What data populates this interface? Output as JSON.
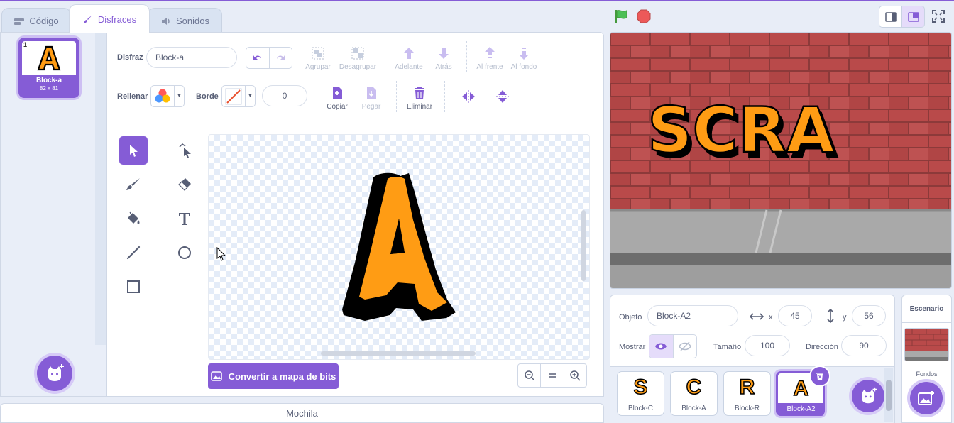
{
  "tabs": {
    "code": "Código",
    "costumes": "Disfraces",
    "sounds": "Sonidos"
  },
  "costume_list": [
    {
      "index": "1",
      "name": "Block-a",
      "size": "82 x 81"
    }
  ],
  "editor": {
    "costume_label": "Disfraz",
    "costume_name": "Block-a",
    "group": "Agrupar",
    "ungroup": "Desagrupar",
    "forward": "Adelante",
    "backward": "Atrás",
    "front": "Al frente",
    "back": "Al fondo",
    "fill_label": "Rellenar",
    "outline_label": "Borde",
    "outline_width": "0",
    "copy": "Copiar",
    "paste": "Pegar",
    "delete": "Eliminar",
    "convert_button": "Convertir a mapa de bits",
    "canvas_letter": "A"
  },
  "backpack": "Mochila",
  "stage": {
    "text": "SCRA"
  },
  "sprite_info": {
    "sprite_label": "Objeto",
    "sprite_name": "Block-A2",
    "x_label": "x",
    "x": "45",
    "y_label": "y",
    "y": "56",
    "show_label": "Mostrar",
    "size_label": "Tamaño",
    "size": "100",
    "direction_label": "Dirección",
    "direction": "90"
  },
  "sprites": [
    {
      "name": "Block-C",
      "letter": "S"
    },
    {
      "name": "Block-A",
      "letter": "C"
    },
    {
      "name": "Block-R",
      "letter": "R"
    },
    {
      "name": "Block-A2",
      "letter": "A"
    }
  ],
  "stage_panel": {
    "title": "Escenario",
    "backdrops_label": "Fondos"
  },
  "colors": {
    "accent": "#855cd6",
    "letter_fill": "#ff9c14",
    "letter_outline": "#000000",
    "brick": "#b94a4a",
    "flag": "#4cbf56",
    "stop": "#ec5959"
  }
}
